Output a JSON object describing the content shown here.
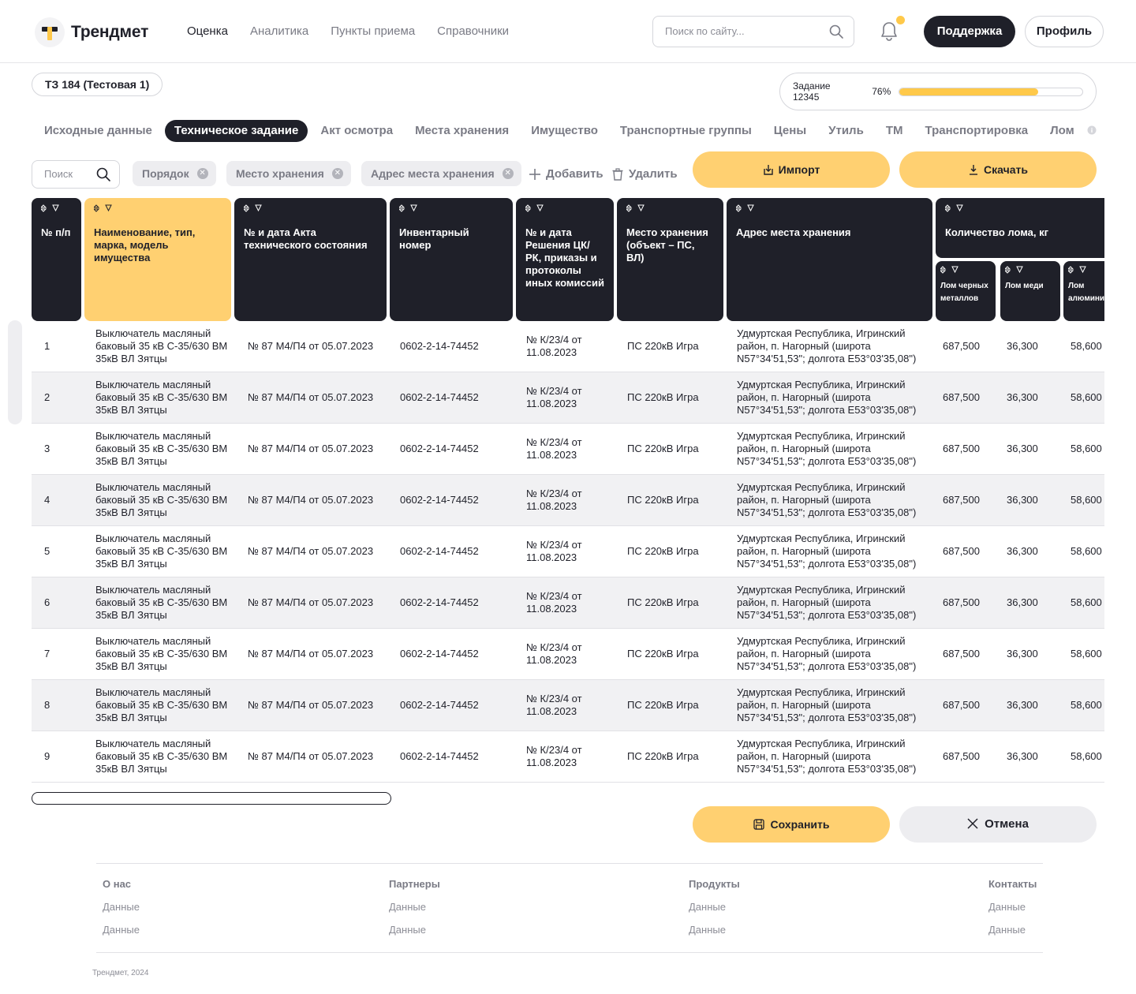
{
  "header": {
    "logo": "Трендмет",
    "nav": [
      "Оценка",
      "Аналитика",
      "Пункты приема",
      "Справочники"
    ],
    "search_placeholder": "Поиск по сайту...",
    "support_label": "Поддержка",
    "profile_label": "Профиль"
  },
  "task": {
    "badge": "ТЗ 184 (Тестовая 1)",
    "progress_label": "Задание 12345",
    "progress_pct": "76%",
    "progress_value": 0.76
  },
  "tabs": [
    "Исходные данные",
    "Техническое задание",
    "Акт осмотра",
    "Места хранения",
    "Имущество",
    "Транспортные группы",
    "Цены",
    "Утиль",
    "ТМ",
    "Транспортировка",
    "Лом"
  ],
  "active_tab": 1,
  "toolbar": {
    "search_placeholder": "Поиск",
    "chips": [
      "Порядок",
      "Место хранения",
      "Адрес места хранения"
    ],
    "add_label": "Добавить",
    "delete_label": "Удалить",
    "import_label": "Импорт",
    "download_label": "Скачать"
  },
  "table": {
    "columns": [
      "№ п/п",
      "Наименование, тип, марка, модель имущества",
      "№ и дата Акта технического состояния",
      "Инвентарный номер",
      "№ и дата Решения ЦК/РК, приказы и протоколы иных комиссий",
      "Место хранения (объект – ПС, ВЛ)",
      "Адрес места хранения",
      "Количество лома, кг"
    ],
    "subcolumns": [
      "Лом черных металлов",
      "Лом меди",
      "Лом алюминия"
    ],
    "rows": [
      {
        "n": "1",
        "name": "Выключатель масляный баковый 35 кВ С-35/630 ВМ 35кВ ВЛ Зятцы",
        "act": "№ 87 М4/П4 от 05.07.2023",
        "inv": "0602-2-14-74452",
        "dec": "№ К/23/4 от 11.08.2023",
        "place": "ПС 220кВ Игра",
        "addr": "Удмуртская Республика, Игринский район, п. Нагорный (широта N57°34'51,53\"; долгота E53°03'35,08\")",
        "fe": "687,500",
        "cu": "36,300",
        "al": "58,600"
      },
      {
        "n": "2",
        "name": "Выключатель масляный баковый 35 кВ С-35/630 ВМ 35кВ ВЛ Зятцы",
        "act": "№ 87 М4/П4 от 05.07.2023",
        "inv": "0602-2-14-74452",
        "dec": "№ К/23/4 от 11.08.2023",
        "place": "ПС 220кВ Игра",
        "addr": "Удмуртская Республика, Игринский район, п. Нагорный (широта N57°34'51,53\"; долгота E53°03'35,08\")",
        "fe": "687,500",
        "cu": "36,300",
        "al": "58,600"
      },
      {
        "n": "3",
        "name": "Выключатель масляный баковый 35 кВ С-35/630 ВМ 35кВ ВЛ Зятцы",
        "act": "№ 87 М4/П4 от 05.07.2023",
        "inv": "0602-2-14-74452",
        "dec": "№ К/23/4 от 11.08.2023",
        "place": "ПС 220кВ Игра",
        "addr": "Удмуртская Республика, Игринский район, п. Нагорный (широта N57°34'51,53\"; долгота E53°03'35,08\")",
        "fe": "687,500",
        "cu": "36,300",
        "al": "58,600"
      },
      {
        "n": "4",
        "name": "Выключатель масляный баковый 35 кВ С-35/630 ВМ 35кВ ВЛ Зятцы",
        "act": "№ 87 М4/П4 от 05.07.2023",
        "inv": "0602-2-14-74452",
        "dec": "№ К/23/4 от 11.08.2023",
        "place": "ПС 220кВ Игра",
        "addr": "Удмуртская Республика, Игринский район, п. Нагорный (широта N57°34'51,53\"; долгота E53°03'35,08\")",
        "fe": "687,500",
        "cu": "36,300",
        "al": "58,600"
      },
      {
        "n": "5",
        "name": "Выключатель масляный баковый 35 кВ С-35/630 ВМ 35кВ ВЛ Зятцы",
        "act": "№ 87 М4/П4 от 05.07.2023",
        "inv": "0602-2-14-74452",
        "dec": "№ К/23/4 от 11.08.2023",
        "place": "ПС 220кВ Игра",
        "addr": "Удмуртская Республика, Игринский район, п. Нагорный (широта N57°34'51,53\"; долгота E53°03'35,08\")",
        "fe": "687,500",
        "cu": "36,300",
        "al": "58,600"
      },
      {
        "n": "6",
        "name": "Выключатель масляный баковый 35 кВ С-35/630 ВМ 35кВ ВЛ Зятцы",
        "act": "№ 87 М4/П4 от 05.07.2023",
        "inv": "0602-2-14-74452",
        "dec": "№ К/23/4 от 11.08.2023",
        "place": "ПС 220кВ Игра",
        "addr": "Удмуртская Республика, Игринский район, п. Нагорный (широта N57°34'51,53\"; долгота E53°03'35,08\")",
        "fe": "687,500",
        "cu": "36,300",
        "al": "58,600"
      },
      {
        "n": "7",
        "name": "Выключатель масляный баковый 35 кВ С-35/630 ВМ 35кВ ВЛ Зятцы",
        "act": "№ 87 М4/П4 от 05.07.2023",
        "inv": "0602-2-14-74452",
        "dec": "№ К/23/4 от 11.08.2023",
        "place": "ПС 220кВ Игра",
        "addr": "Удмуртская Республика, Игринский район, п. Нагорный (широта N57°34'51,53\"; долгота E53°03'35,08\")",
        "fe": "687,500",
        "cu": "36,300",
        "al": "58,600"
      },
      {
        "n": "8",
        "name": "Выключатель масляный баковый 35 кВ С-35/630 ВМ 35кВ ВЛ Зятцы",
        "act": "№ 87 М4/П4 от 05.07.2023",
        "inv": "0602-2-14-74452",
        "dec": "№ К/23/4 от 11.08.2023",
        "place": "ПС 220кВ Игра",
        "addr": "Удмуртская Республика, Игринский район, п. Нагорный (широта N57°34'51,53\"; долгота E53°03'35,08\")",
        "fe": "687,500",
        "cu": "36,300",
        "al": "58,600"
      },
      {
        "n": "9",
        "name": "Выключатель масляный баковый 35 кВ С-35/630 ВМ 35кВ ВЛ Зятцы",
        "act": "№ 87 М4/П4 от 05.07.2023",
        "inv": "0602-2-14-74452",
        "dec": "№ К/23/4 от 11.08.2023",
        "place": "ПС 220кВ Игра",
        "addr": "Удмуртская Республика, Игринский район, п. Нагорный (широта N57°34'51,53\"; долгота E53°03'35,08\")",
        "fe": "687,500",
        "cu": "36,300",
        "al": "58,600"
      }
    ]
  },
  "actions": {
    "save_label": "Сохранить",
    "cancel_label": "Отмена"
  },
  "footer": {
    "columns": [
      {
        "title": "О нас",
        "items": [
          "Данные",
          "Данные"
        ]
      },
      {
        "title": "Партнеры",
        "items": [
          "Данные",
          "Данные"
        ]
      },
      {
        "title": "Продукты",
        "items": [
          "Данные",
          "Данные"
        ]
      },
      {
        "title": "Контакты",
        "items": [
          "Данные",
          "Данные"
        ]
      }
    ],
    "copyright": "Трендмет, 2024"
  },
  "colors": {
    "accent": "#ffd071",
    "dark": "#1f2029",
    "muted": "#7a7b85"
  }
}
